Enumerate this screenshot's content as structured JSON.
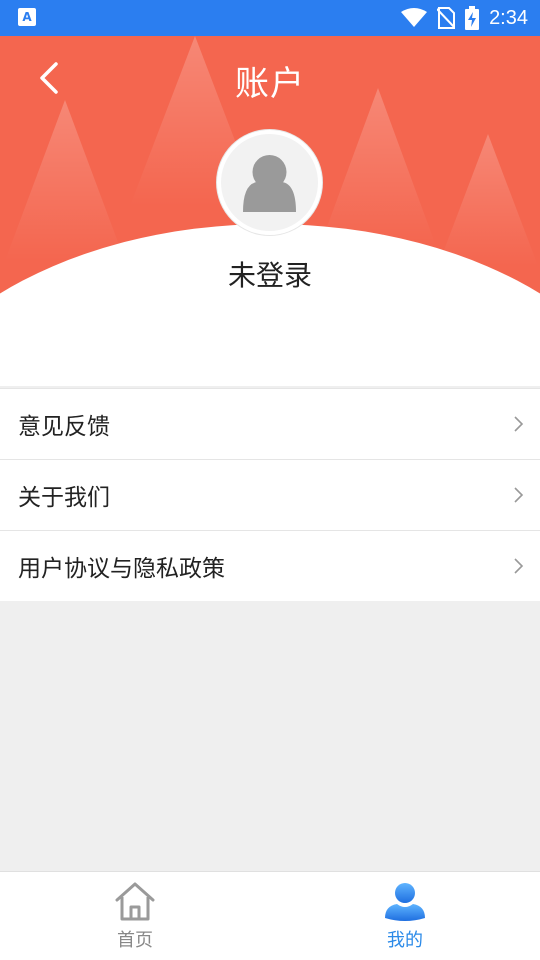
{
  "status_bar": {
    "time": "2:34",
    "left_icon": "a-letter-icon",
    "right_icons": [
      "wifi-icon",
      "no-sim-icon",
      "battery-charging-icon"
    ]
  },
  "header": {
    "title": "账户",
    "back_icon": "back-arrow-icon",
    "background_color": "#f4664f",
    "avatar_icon": "user-silhouette-icon",
    "login_status": "未登录"
  },
  "menu": {
    "items": [
      {
        "label": "意见反馈",
        "icon": "chevron-right-icon"
      },
      {
        "label": "关于我们",
        "icon": "chevron-right-icon"
      },
      {
        "label": "用户协议与隐私政策",
        "icon": "chevron-right-icon"
      }
    ]
  },
  "tabbar": {
    "tabs": [
      {
        "label": "首页",
        "icon": "home-icon",
        "active": false,
        "color": "#888888"
      },
      {
        "label": "我的",
        "icon": "user-icon",
        "active": true,
        "color": "#2b8ae8"
      }
    ]
  }
}
